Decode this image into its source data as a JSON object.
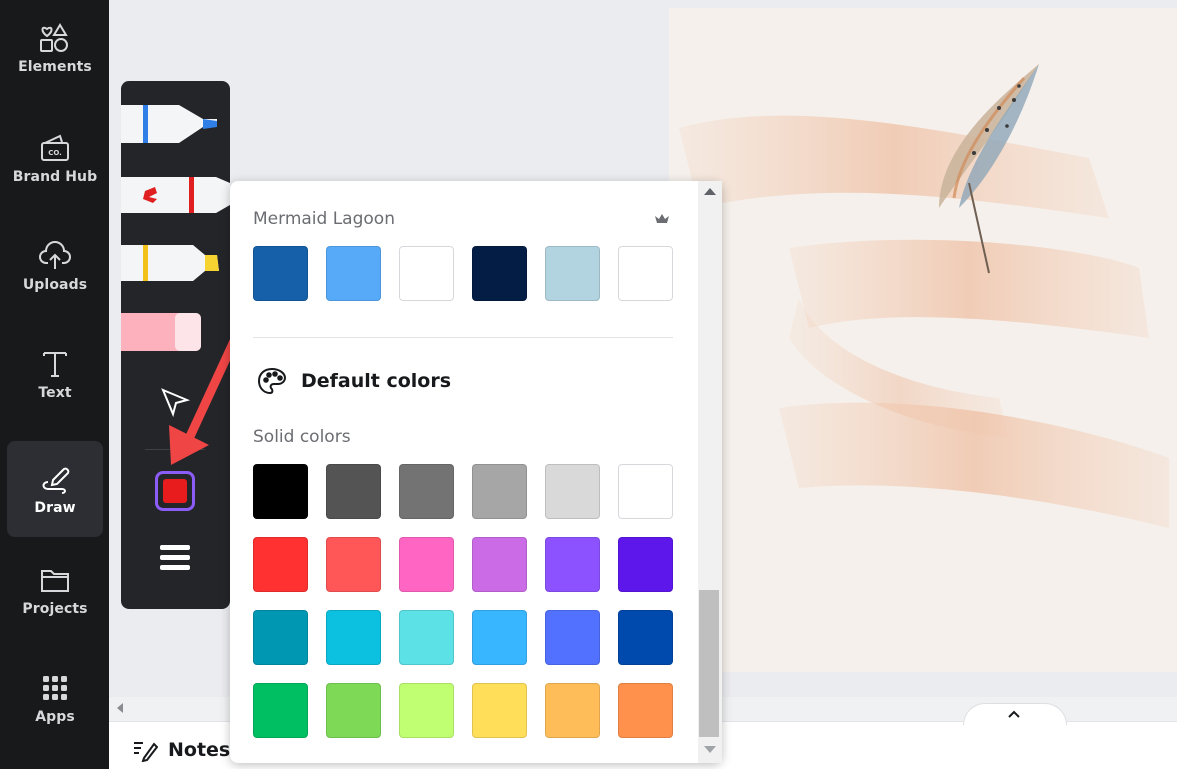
{
  "sidebar": {
    "items": [
      {
        "label": "Elements",
        "icon": "elements-icon"
      },
      {
        "label": "Brand Hub",
        "icon": "brand-hub-icon"
      },
      {
        "label": "Uploads",
        "icon": "cloud-upload-icon"
      },
      {
        "label": "Text",
        "icon": "text-icon"
      },
      {
        "label": "Draw",
        "icon": "draw-icon",
        "active": true
      },
      {
        "label": "Projects",
        "icon": "folder-icon"
      },
      {
        "label": "Apps",
        "icon": "apps-grid-icon"
      }
    ],
    "brand_hub_badge": "CO."
  },
  "bottom_bar": {
    "notes_label": "Notes"
  },
  "draw_tools": {
    "current_color": "#e81c1c",
    "tools": [
      "pen",
      "marker",
      "highlighter",
      "eraser",
      "select"
    ]
  },
  "color_panel": {
    "brand_kit_title": "Mermaid Lagoon",
    "brand_kit_colors": [
      "#1560a8",
      "#56aaf7",
      "#ffffff",
      "#041d44",
      "#b2d3e0",
      "#ffffff"
    ],
    "default_colors_label": "Default colors",
    "solid_colors_label": "Solid colors",
    "solid_colors": [
      [
        "#000000",
        "#545454",
        "#737373",
        "#a6a6a6",
        "#d9d9d9",
        "#ffffff"
      ],
      [
        "#ff3131",
        "#ff5757",
        "#ff66c4",
        "#cb6ce6",
        "#8c52ff",
        "#5e17eb"
      ],
      [
        "#0097b2",
        "#0cc0df",
        "#5ce1e6",
        "#38b6ff",
        "#5271ff",
        "#004aad"
      ],
      [
        "#00bf63",
        "#7ed957",
        "#c1ff72",
        "#ffde59",
        "#ffbd59",
        "#ff914d"
      ]
    ]
  }
}
